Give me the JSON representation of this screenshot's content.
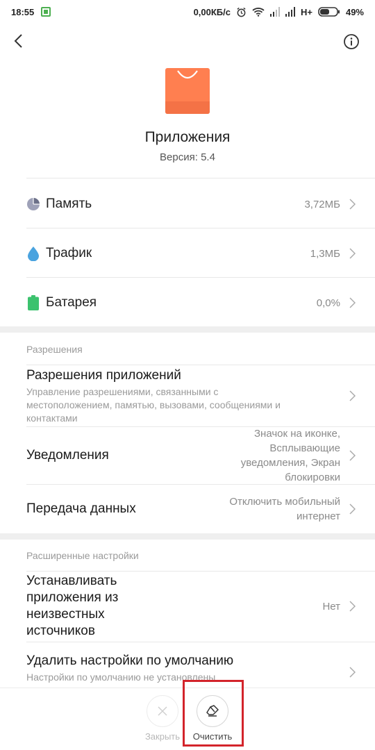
{
  "status_bar": {
    "time": "18:55",
    "network_speed": "0,00КБ/с",
    "network_type": "H+",
    "battery": "49%",
    "icons": [
      "notification-icon",
      "alarm-icon",
      "wifi-icon",
      "signal-icon",
      "battery-icon"
    ]
  },
  "nav": {
    "back_icon": "back-arrow-icon",
    "info_icon": "info-icon"
  },
  "app": {
    "name": "Приложения",
    "version": "Версия: 5.4",
    "icon": "shopping-bag-icon",
    "icon_color": "#ff7f50"
  },
  "stats": [
    {
      "label": "Память",
      "value": "3,72МБ",
      "icon": "pie-chart-icon",
      "icon_color": "#8c8fa8"
    },
    {
      "label": "Трафик",
      "value": "1,3МБ",
      "icon": "water-drop-icon",
      "icon_color": "#4aa3df"
    },
    {
      "label": "Батарея",
      "value": "0,0%",
      "icon": "battery-icon",
      "icon_color": "#3cc26e"
    }
  ],
  "permissions": {
    "section_title": "Разрешения",
    "app_permissions": {
      "title": "Разрешения приложений",
      "desc_lines": [
        "Управление разрешениями, связанными с",
        "местоположением, памятью, вызовами, сообщениями и",
        "контактами"
      ]
    },
    "notifications": {
      "title": "Уведомления",
      "value_lines": [
        "Значок на иконке,",
        "Всплывающие",
        "уведомления, Экран",
        "блокировки"
      ]
    },
    "data_transfer": {
      "title": "Передача данных",
      "value_lines": [
        "Отключить мобильный",
        "интернет"
      ]
    }
  },
  "advanced": {
    "section_title": "Расширенные настройки",
    "unknown_sources": {
      "title_lines": [
        "Устанавливать",
        "приложения из",
        "неизвестных",
        "источников"
      ],
      "value": "Нет"
    },
    "clear_defaults": {
      "title": "Удалить настройки по умолчанию",
      "desc": "Настройки по умолчанию не установлены"
    }
  },
  "bottom_bar": {
    "close_label": "Закрыть",
    "clear_label": "Очистить",
    "highlight_color": "#d3242b"
  }
}
